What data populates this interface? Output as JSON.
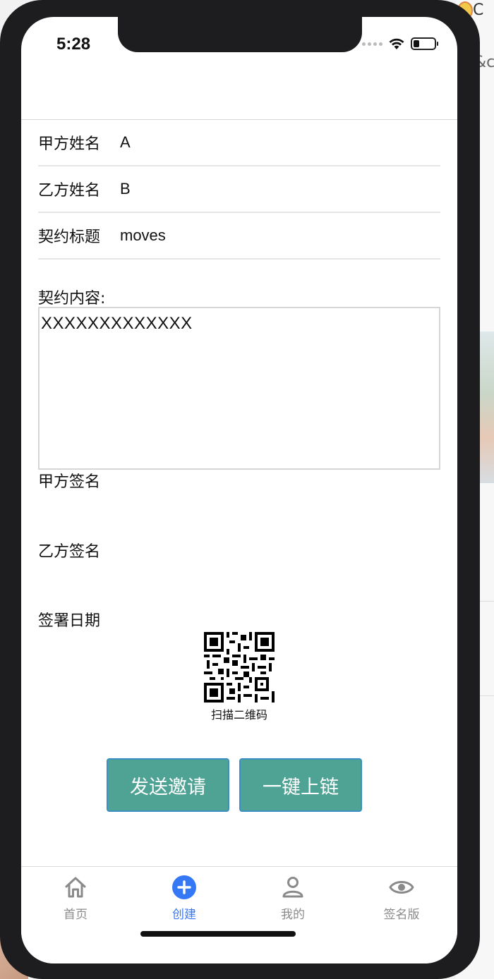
{
  "status_bar": {
    "time": "5:28"
  },
  "background": {
    "right_text_top": "C",
    "right_text_second": "&c"
  },
  "form": {
    "party_a_label": "甲方姓名",
    "party_a_value": "A",
    "party_b_label": "乙方姓名",
    "party_b_value": "B",
    "title_label": "契约标题",
    "title_value": "moves",
    "content_label": "契约内容:",
    "content_value": "XXXXXXXXXXXXX",
    "party_a_sign_label": "甲方签名",
    "party_b_sign_label": "乙方签名",
    "date_label": "签署日期"
  },
  "qr": {
    "caption": "扫描二维码"
  },
  "buttons": {
    "send_invite": "发送邀请",
    "one_click_chain": "一键上链"
  },
  "tabbar": {
    "items": [
      {
        "label": "首页",
        "icon": "home-icon",
        "active": false
      },
      {
        "label": "创建",
        "icon": "plus-circle-icon",
        "active": true
      },
      {
        "label": "我的",
        "icon": "user-icon",
        "active": false
      },
      {
        "label": "签名版",
        "icon": "eye-icon",
        "active": false
      }
    ]
  },
  "colors": {
    "button_bg": "#4fa394",
    "button_border": "#3b8fc2",
    "active_tab": "#3478f6",
    "inactive_tab": "#8a8a8a"
  }
}
